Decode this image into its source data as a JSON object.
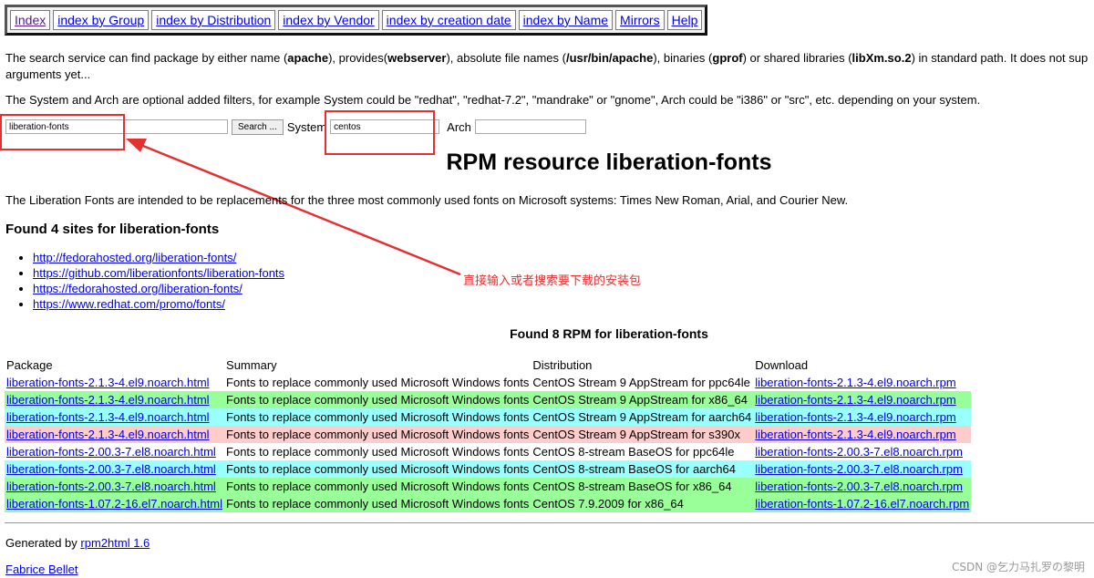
{
  "nav": [
    {
      "label": "Index"
    },
    {
      "label": "index by Group"
    },
    {
      "label": "index by Distribution"
    },
    {
      "label": "index by Vendor"
    },
    {
      "label": "index by creation date"
    },
    {
      "label": "index by Name"
    },
    {
      "label": "Mirrors"
    },
    {
      "label": "Help"
    }
  ],
  "intro": {
    "line1_a": "The search service can find package by either name (",
    "line1_b": "apache",
    "line1_c": "), provides(",
    "line1_d": "webserver",
    "line1_e": "), absolute file names (",
    "line1_f": "/usr/bin/apache",
    "line1_g": "), binaries (",
    "line1_h": "gprof",
    "line1_i": ") or shared libraries (",
    "line1_j": "libXm.so.2",
    "line1_k": ") in standard path. It does not sup",
    "line2": "arguments yet...",
    "filters": "The System and Arch are optional added filters, for example System could be \"redhat\", \"redhat-7.2\", \"mandrake\" or \"gnome\", Arch could be \"i386\" or \"src\", etc. depending on your system."
  },
  "search": {
    "query_value": "liberation-fonts",
    "button_label": "Search ...",
    "system_label": "System",
    "system_value": "centos",
    "arch_label": "Arch",
    "arch_value": ""
  },
  "title": "RPM resource liberation-fonts",
  "description": "The Liberation Fonts are intended to be replacements for the three most commonly used fonts on Microsoft systems: Times New Roman, Arial, and Courier New.",
  "sites_heading": "Found 4 sites for liberation-fonts",
  "sites": [
    "http://fedorahosted.org/liberation-fonts/",
    "https://github.com/liberationfonts/liberation-fonts",
    "https://fedorahosted.org/liberation-fonts/",
    "https://www.redhat.com/promo/fonts/"
  ],
  "annotation": "直接输入或者搜索要下载的安装包",
  "rpm_heading": "Found 8 RPM for liberation-fonts",
  "table": {
    "headers": [
      "Package",
      "Summary",
      "Distribution",
      "Download"
    ],
    "rows": [
      {
        "package": "liberation-fonts-2.1.3-4.el9.noarch.html",
        "summary": "Fonts to replace commonly used Microsoft Windows fonts",
        "distribution": "CentOS Stream 9 AppStream for ppc64le",
        "download": "liberation-fonts-2.1.3-4.el9.noarch.rpm",
        "color": "white"
      },
      {
        "package": "liberation-fonts-2.1.3-4.el9.noarch.html",
        "summary": "Fonts to replace commonly used Microsoft Windows fonts",
        "distribution": "CentOS Stream 9 AppStream for x86_64",
        "download": "liberation-fonts-2.1.3-4.el9.noarch.rpm",
        "color": "green"
      },
      {
        "package": "liberation-fonts-2.1.3-4.el9.noarch.html",
        "summary": "Fonts to replace commonly used Microsoft Windows fonts",
        "distribution": "CentOS Stream 9 AppStream for aarch64",
        "download": "liberation-fonts-2.1.3-4.el9.noarch.rpm",
        "color": "cyan"
      },
      {
        "package": "liberation-fonts-2.1.3-4.el9.noarch.html",
        "summary": "Fonts to replace commonly used Microsoft Windows fonts",
        "distribution": "CentOS Stream 9 AppStream for s390x",
        "download": "liberation-fonts-2.1.3-4.el9.noarch.rpm",
        "color": "pink"
      },
      {
        "package": "liberation-fonts-2.00.3-7.el8.noarch.html",
        "summary": "Fonts to replace commonly used Microsoft Windows fonts",
        "distribution": "CentOS 8-stream BaseOS for ppc64le",
        "download": "liberation-fonts-2.00.3-7.el8.noarch.rpm",
        "color": "white"
      },
      {
        "package": "liberation-fonts-2.00.3-7.el8.noarch.html",
        "summary": "Fonts to replace commonly used Microsoft Windows fonts",
        "distribution": "CentOS 8-stream BaseOS for aarch64",
        "download": "liberation-fonts-2.00.3-7.el8.noarch.rpm",
        "color": "cyan"
      },
      {
        "package": "liberation-fonts-2.00.3-7.el8.noarch.html",
        "summary": "Fonts to replace commonly used Microsoft Windows fonts",
        "distribution": "CentOS 8-stream BaseOS for x86_64",
        "download": "liberation-fonts-2.00.3-7.el8.noarch.rpm",
        "color": "green"
      },
      {
        "package": "liberation-fonts-1.07.2-16.el7.noarch.html",
        "summary": "Fonts to replace commonly used Microsoft Windows fonts",
        "distribution": "CentOS 7.9.2009 for x86_64",
        "download": "liberation-fonts-1.07.2-16.el7.noarch.rpm",
        "color": "green"
      }
    ]
  },
  "footer": {
    "generated_prefix": "Generated by",
    "generator_link": "rpm2html 1.6",
    "author_link": "Fabrice Bellet"
  },
  "watermark": "CSDN @乞力马扎罗の黎明",
  "colors": {
    "annotation_red": "#e53030",
    "row_green": "#99ff99",
    "row_cyan": "#99ffff",
    "row_pink": "#ffcccc"
  }
}
